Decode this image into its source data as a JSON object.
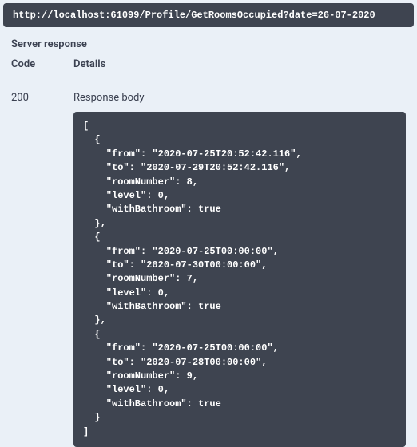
{
  "url": "http://localhost:61099/Profile/GetRoomsOccupied?date=26-07-2020",
  "sections": {
    "server_response": "Server response",
    "code_header": "Code",
    "details_header": "Details",
    "response_body_label": "Response body"
  },
  "status_code": "200",
  "response_body": "[\n  {\n    \"from\": \"2020-07-25T20:52:42.116\",\n    \"to\": \"2020-07-29T20:52:42.116\",\n    \"roomNumber\": 8,\n    \"level\": 0,\n    \"withBathroom\": true\n  },\n  {\n    \"from\": \"2020-07-25T00:00:00\",\n    \"to\": \"2020-07-30T00:00:00\",\n    \"roomNumber\": 7,\n    \"level\": 0,\n    \"withBathroom\": true\n  },\n  {\n    \"from\": \"2020-07-25T00:00:00\",\n    \"to\": \"2020-07-28T00:00:00\",\n    \"roomNumber\": 9,\n    \"level\": 0,\n    \"withBathroom\": true\n  }\n]"
}
